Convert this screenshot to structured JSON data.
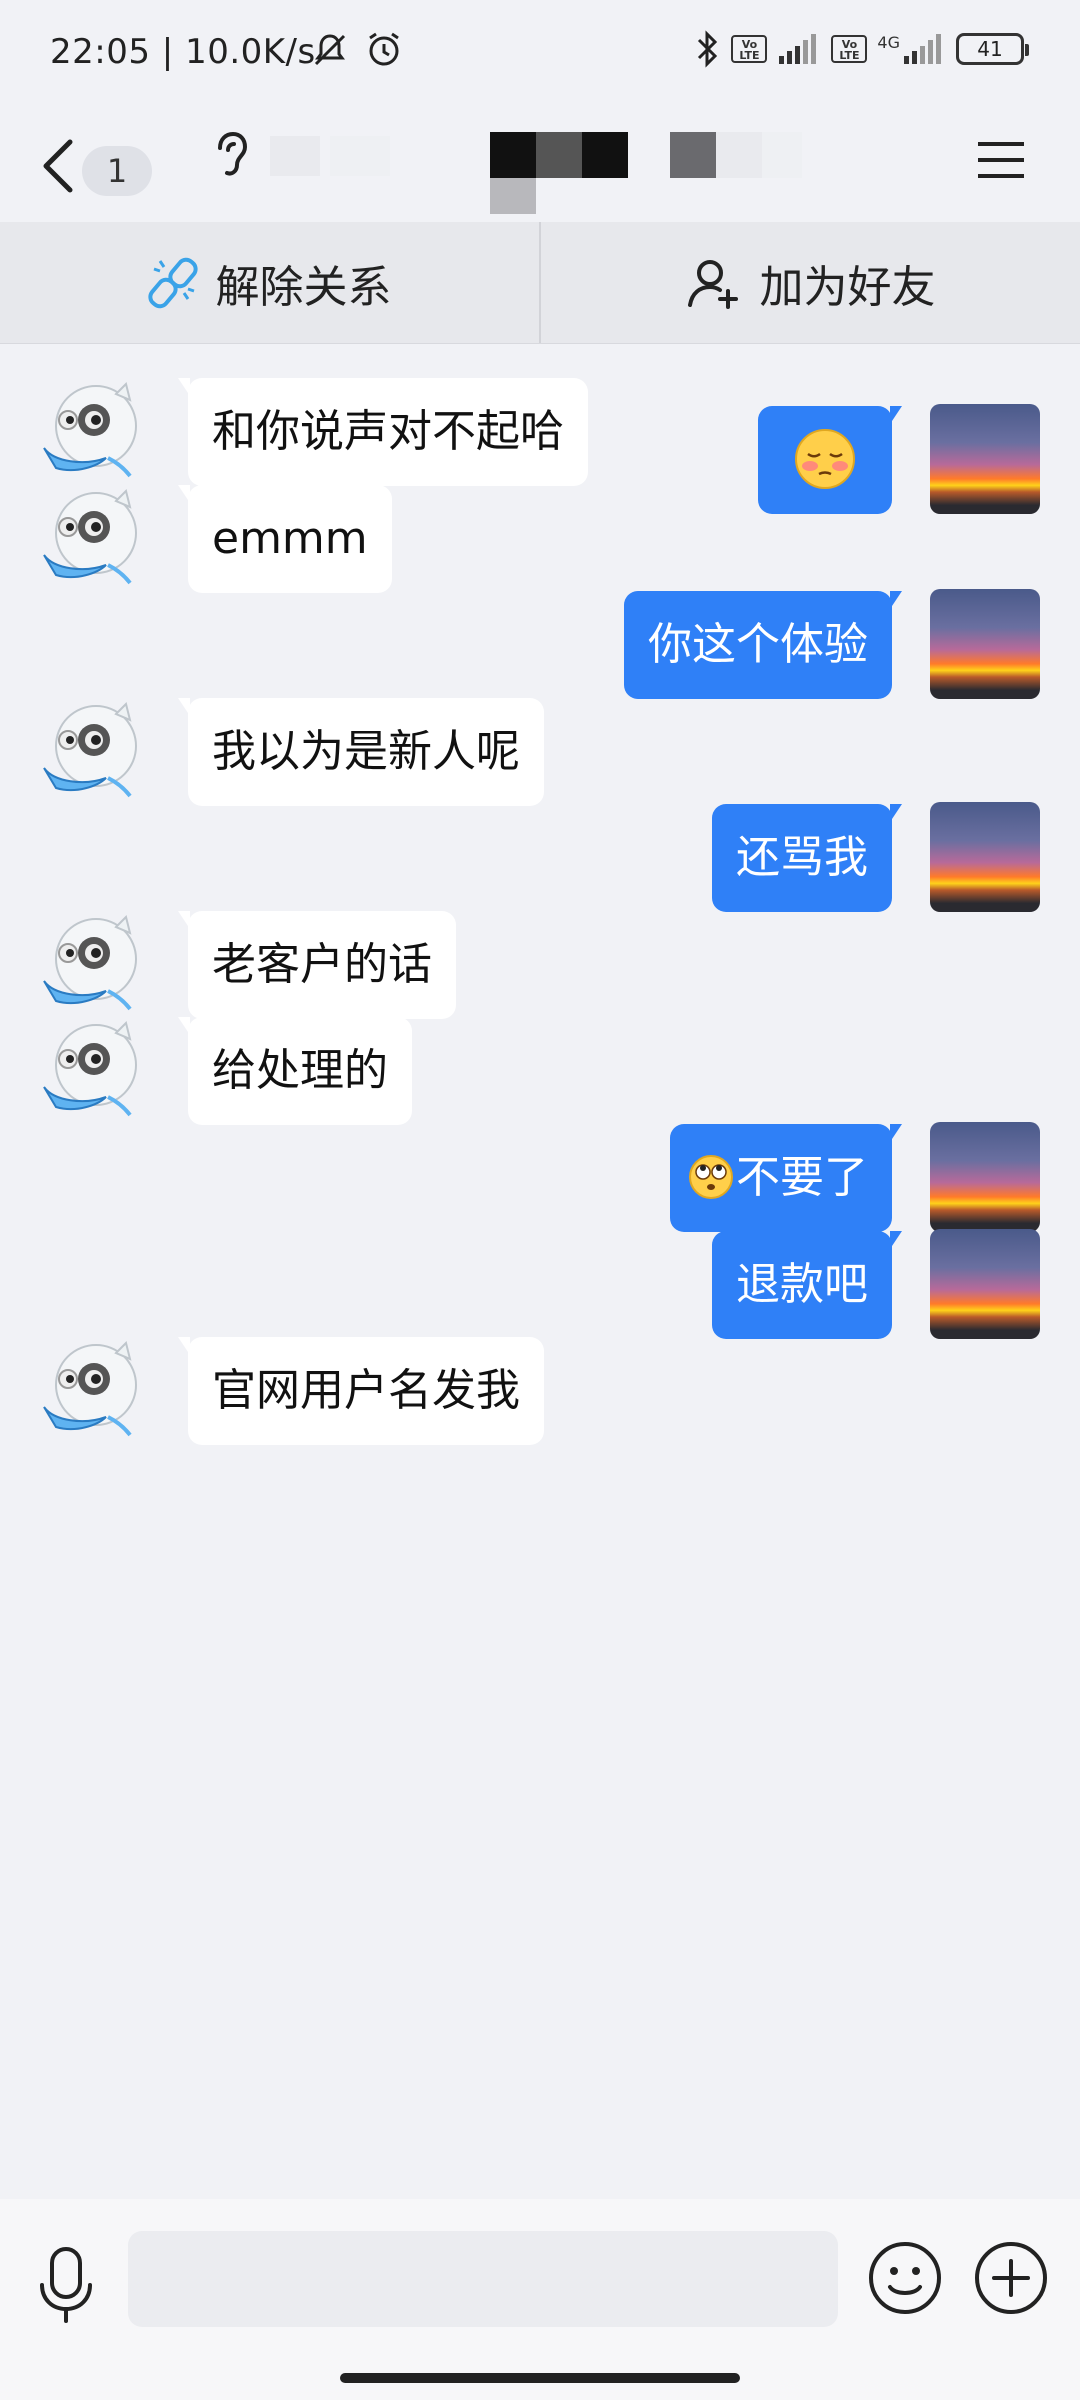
{
  "status_bar": {
    "time": "22:05",
    "speed": "10.0K/s",
    "volte": "Vo LTE",
    "network": "4G",
    "battery": "41"
  },
  "title_bar": {
    "unread_count": "1"
  },
  "actions": {
    "unlink_label": "解除关系",
    "add_friend_label": "加为好友"
  },
  "messages": [
    {
      "from": "me",
      "text": "",
      "emoji": "flushed-face"
    },
    {
      "from": "peer",
      "text": "和你说声对不起哈"
    },
    {
      "from": "peer",
      "text": "emmm"
    },
    {
      "from": "me",
      "text": "你这个体验"
    },
    {
      "from": "peer",
      "text": "我以为是新人呢"
    },
    {
      "from": "me",
      "text": "还骂我"
    },
    {
      "from": "peer",
      "text": "老客户的话"
    },
    {
      "from": "peer",
      "text": "给处理的"
    },
    {
      "from": "me",
      "text": "不要了",
      "emoji": "eye-roll-face"
    },
    {
      "from": "me",
      "text": "退款吧"
    },
    {
      "from": "peer",
      "text": "官网用户名发我"
    }
  ],
  "input": {
    "placeholder": ""
  },
  "colors": {
    "accent": "#2f80f7",
    "background": "#f1f2f6"
  }
}
